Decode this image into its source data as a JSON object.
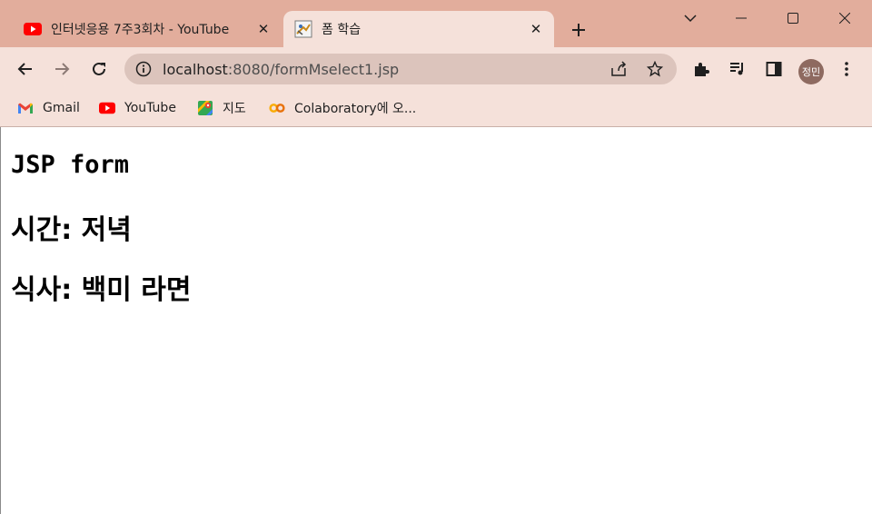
{
  "browser": {
    "tabs": [
      {
        "title": "인터넷응용 7주3회차 - YouTube",
        "favicon": "youtube-icon",
        "active": false
      },
      {
        "title": "폼 학습",
        "favicon": "page-favicon-icon",
        "active": true
      }
    ],
    "address_bar": {
      "host": "localhost",
      "path": ":8080/formMselect1.jsp"
    },
    "profile_label": "정민",
    "bookmarks": [
      {
        "label": "Gmail",
        "icon": "gmail-icon"
      },
      {
        "label": "YouTube",
        "icon": "youtube-icon"
      },
      {
        "label": "지도",
        "icon": "maps-icon"
      },
      {
        "label": "Colaboratory에 오...",
        "icon": "colab-icon"
      }
    ],
    "colors": {
      "tabstrip": "#e2ad9c",
      "toolbar": "#f5e1da",
      "omnibox": "#dcc4bc",
      "avatar": "#8e6a60"
    }
  },
  "page": {
    "heading": "JSP form",
    "time_line": "시간: 저녁",
    "meal_line": "식사: 백미 라면"
  }
}
